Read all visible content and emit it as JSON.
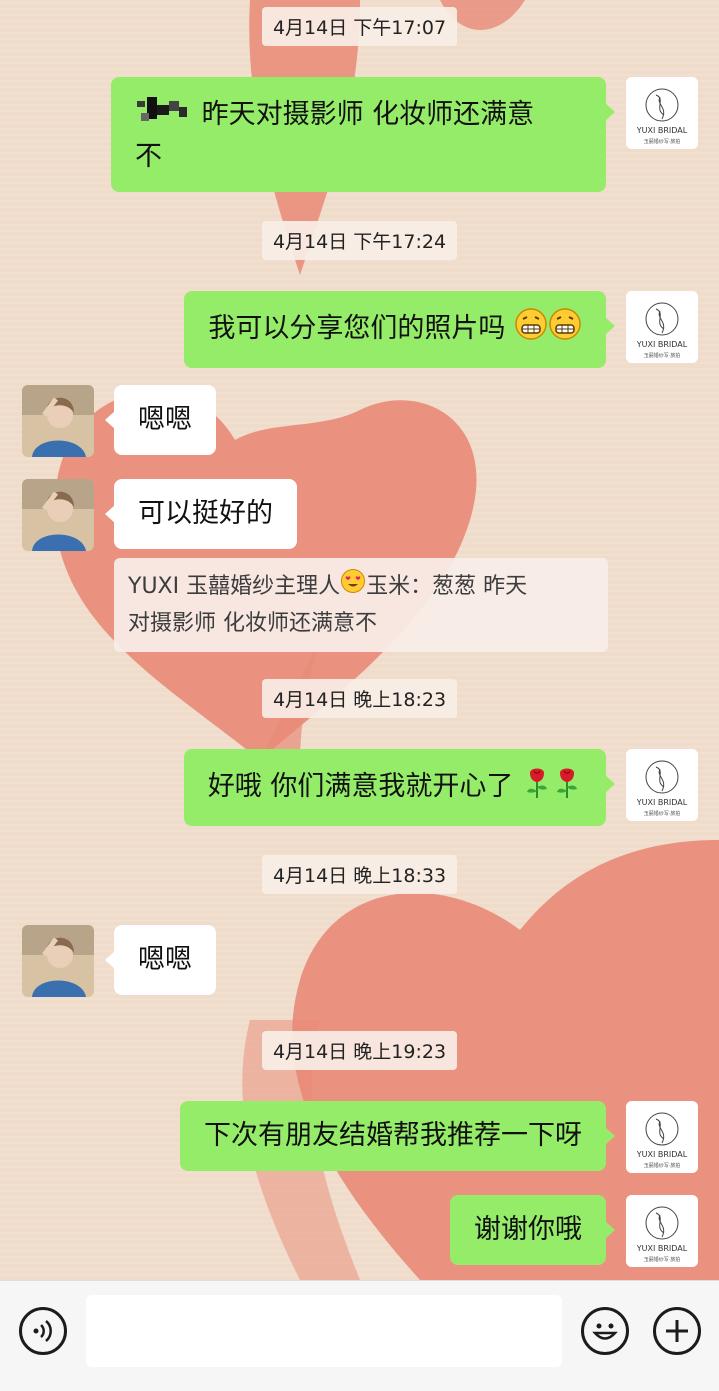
{
  "colors": {
    "sent_bubble": "#95ec69",
    "received_bubble": "#ffffff",
    "background": "#efdccb",
    "heart": "#e98a77"
  },
  "timestamps": [
    "4月14日 下午17:07",
    "4月14日 下午17:24",
    "4月14日 晚上18:23",
    "4月14日 晚上18:33",
    "4月14日 晚上19:23"
  ],
  "messages": [
    {
      "side": "sent",
      "line1": "昨天对摄影师 化妆师还满意",
      "line2": "不"
    },
    {
      "side": "sent",
      "text": "我可以分享您们的照片吗",
      "emoji": [
        "grin-icon",
        "grin-icon"
      ]
    },
    {
      "side": "received",
      "text": "嗯嗯"
    },
    {
      "side": "received",
      "text": "可以挺好的"
    },
    {
      "side": "sent",
      "text": "好哦 你们满意我就开心了",
      "emoji": [
        "rose-icon",
        "rose-icon"
      ]
    },
    {
      "side": "received",
      "text": "嗯嗯"
    },
    {
      "side": "sent",
      "text": "下次有朋友结婚帮我推荐一下呀"
    },
    {
      "side": "sent",
      "text": "谢谢你哦"
    }
  ],
  "quote": {
    "author_prefix": "YUXI 玉囍婚纱主理人",
    "author_emoji": "heart-eyes-icon",
    "author_suffix": "玉米：",
    "line1_text": "葱葱 昨天",
    "line2_text": "对摄影师 化妆师还满意不"
  },
  "brand_avatar": {
    "name": "YUXI BRIDAL",
    "subtitle": "玉囍婚纱写·旅拍"
  },
  "input_bar": {
    "icons": [
      "voice-icon",
      "emoji-icon",
      "plus-icon"
    ]
  }
}
